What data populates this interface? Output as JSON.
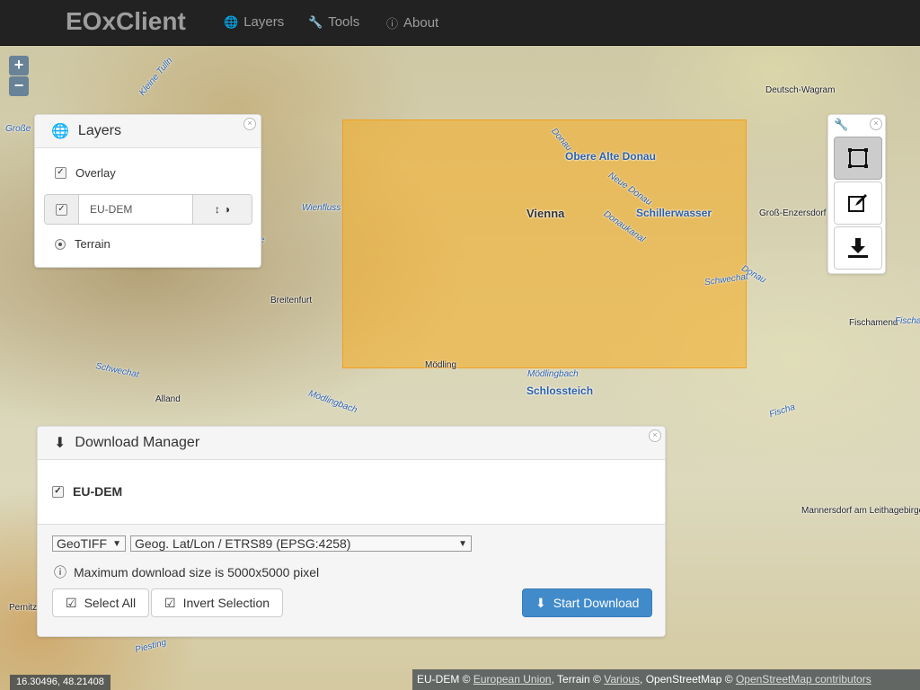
{
  "navbar": {
    "brand": "EOxClient",
    "items": [
      {
        "icon": "globe-icon",
        "label": "Layers"
      },
      {
        "icon": "wrench-icon",
        "label": "Tools"
      },
      {
        "icon": "info-icon",
        "label": "About"
      }
    ]
  },
  "zoom": {
    "in": "+",
    "out": "−"
  },
  "map_labels": {
    "vienna": "Vienna",
    "obere_alte_donau": "Obere Alte Donau",
    "schillerwasser": "Schillerwasser",
    "schlossteich": "Schlossteich",
    "deutsch_wagram": "Deutsch-Wagram",
    "gross_enzersdorf": "Groß-Enzersdorf",
    "fischamend": "Fischamend",
    "fischa": "Fischa",
    "fischa2": "Fischa",
    "mannersdorf": "Mannersdorf am Leithagebirge",
    "breitenfurt": "Breitenfurt",
    "alland": "Alland",
    "moedling": "Mödling",
    "moedlingbach": "Mödlingbach",
    "moedlingbach2": "Mödlingbach",
    "wienfluss": "Wienfluss",
    "schwechat": "Schwechat",
    "schwechat2": "Schwechat",
    "donau": "Donau",
    "donau2": "Donau",
    "neue_donau": "Neue Donau",
    "donaukanal": "Donaukanal",
    "kleine_tulln": "Kleine Tulln",
    "grosse": "Große",
    "perniz": "Pernitz",
    "piesting": "Piesting",
    "e": "e"
  },
  "layers_panel": {
    "title": "Layers",
    "overlay_label": "Overlay",
    "overlay_checked": true,
    "layer_name": "EU-DEM",
    "layer_checked": true,
    "terrain_label": "Terrain",
    "terrain_selected": true
  },
  "tools_panel": {
    "tools": [
      {
        "icon": "bounding-box-icon",
        "active": true
      },
      {
        "icon": "edit-icon",
        "active": false
      },
      {
        "icon": "download-icon",
        "active": false
      }
    ]
  },
  "download_manager": {
    "title": "Download Manager",
    "layer_label": "EU-DEM",
    "layer_checked": true,
    "format_value": "GeoTIFF",
    "projection_value": "Geog. Lat/Lon / ETRS89 (EPSG:4258)",
    "info_text": "Maximum download size is 5000x5000 pixel",
    "select_all_label": "Select All",
    "invert_selection_label": "Invert Selection",
    "start_download_label": "Start Download"
  },
  "status": {
    "coordinates": "16.30496, 48.21408",
    "attribution_eudem_prefix": "EU-DEM ©",
    "attribution_eudem_link": "European Union",
    "attribution_terrain_prefix": ", Terrain ©",
    "attribution_terrain_link": "Various",
    "attribution_osm_prefix": ", OpenStreetMap ©",
    "attribution_osm_link": "OpenStreetMap contributors"
  },
  "colors": {
    "navbar": "#222222",
    "selection_fill": "#f6ac1e",
    "primary_button": "#428bca",
    "water_label": "#2b5fa8"
  }
}
